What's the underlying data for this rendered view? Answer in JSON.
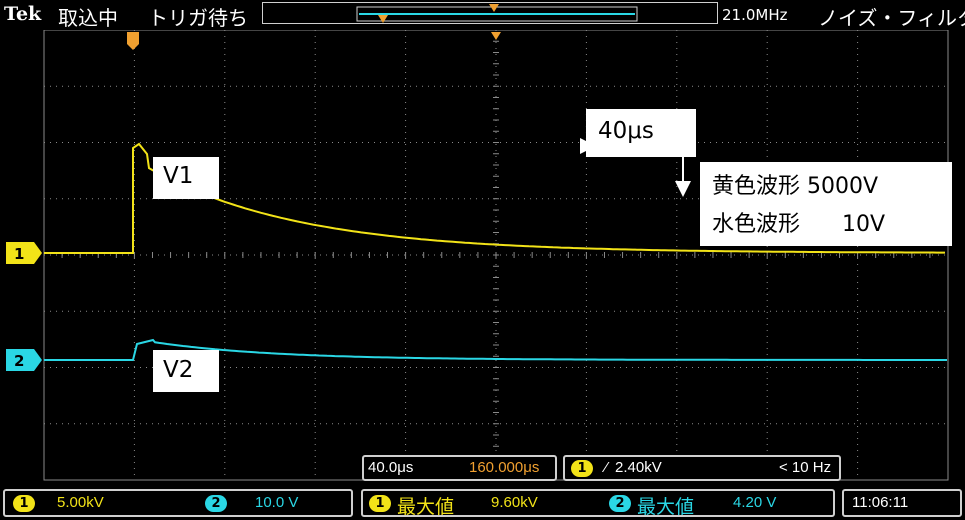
{
  "status_bar": {
    "brand": "Tek",
    "acquisition_state": "取込中",
    "trigger_state": "トリガ待ち",
    "bandwidth": "21.0MHz",
    "filter_label": "ノイズ・フィルタ"
  },
  "annotations": {
    "trace1_label": "V1",
    "trace2_label": "V2",
    "time_span": "40μs",
    "legend_line1": "黄色波形 5000V",
    "legend_line2": "水色波形      10V"
  },
  "horizontal": {
    "timebase": "40.0μs",
    "position": "160.000μs"
  },
  "trigger": {
    "channel": "1",
    "level": "2.40kV",
    "frequency": "< 10 Hz"
  },
  "channels": [
    {
      "id": "1",
      "scale": "5.00kV",
      "color": "#f2e318"
    },
    {
      "id": "2",
      "scale": "10.0 V",
      "color": "#2ad7e5"
    }
  ],
  "measurements": [
    {
      "channel": "1",
      "label": "最大値",
      "value": "9.60kV"
    },
    {
      "channel": "2",
      "label": "最大値",
      "value": "4.20 V"
    }
  ],
  "clock": "11:06:11",
  "colors": {
    "grid": "#8a8a8a",
    "ch1": "#f2e318",
    "ch2": "#2ad7e5",
    "trigger_marker": "#f0a030"
  }
}
